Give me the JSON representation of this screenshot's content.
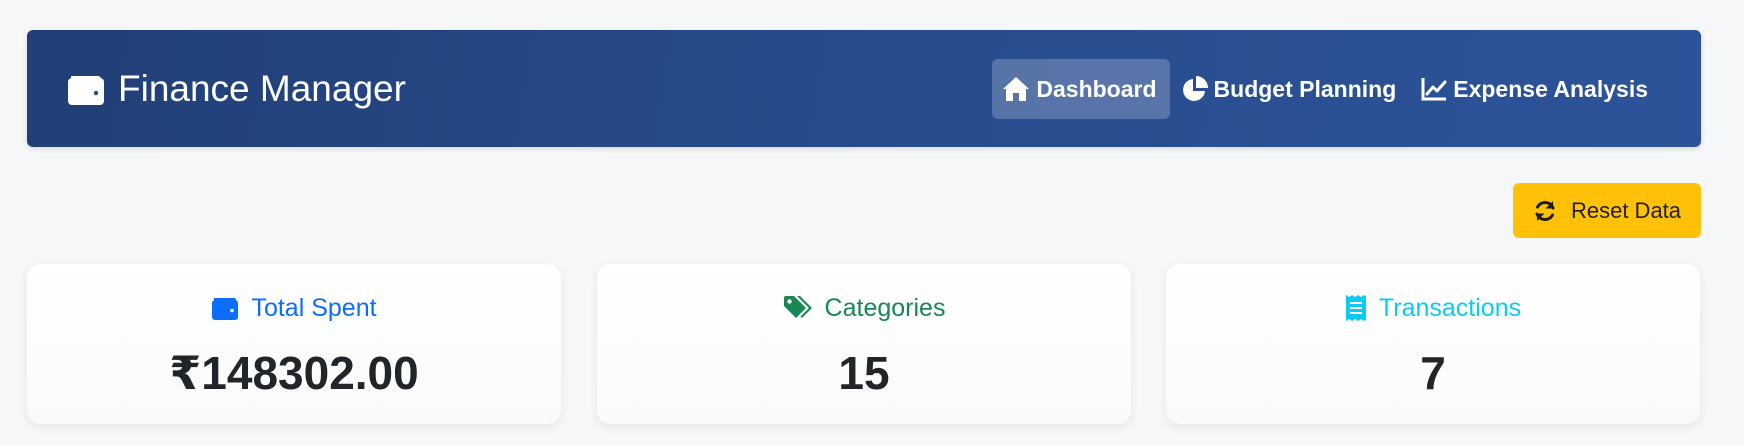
{
  "app": {
    "title": "Finance Manager",
    "brand_icon": "wallet-icon"
  },
  "nav": {
    "items": [
      {
        "label": "Dashboard",
        "icon": "home-icon",
        "active": true
      },
      {
        "label": "Budget Planning",
        "icon": "pie-chart-icon",
        "active": false
      },
      {
        "label": "Expense Analysis",
        "icon": "line-chart-icon",
        "active": false
      }
    ]
  },
  "actions": {
    "reset_label": "Reset Data",
    "reset_icon": "refresh-icon",
    "reset_color": "#ffc107"
  },
  "stats": [
    {
      "label": "Total Spent",
      "value": "₹148302.00",
      "icon": "wallet-icon",
      "color": "#0d6efd"
    },
    {
      "label": "Categories",
      "value": "15",
      "icon": "tags-icon",
      "color": "#198754"
    },
    {
      "label": "Transactions",
      "value": "7",
      "icon": "receipt-icon",
      "color": "#0dcaf0"
    }
  ],
  "colors": {
    "navbar_start": "#213f76",
    "navbar_end": "#2c5399",
    "background": "#f6f7f9"
  }
}
